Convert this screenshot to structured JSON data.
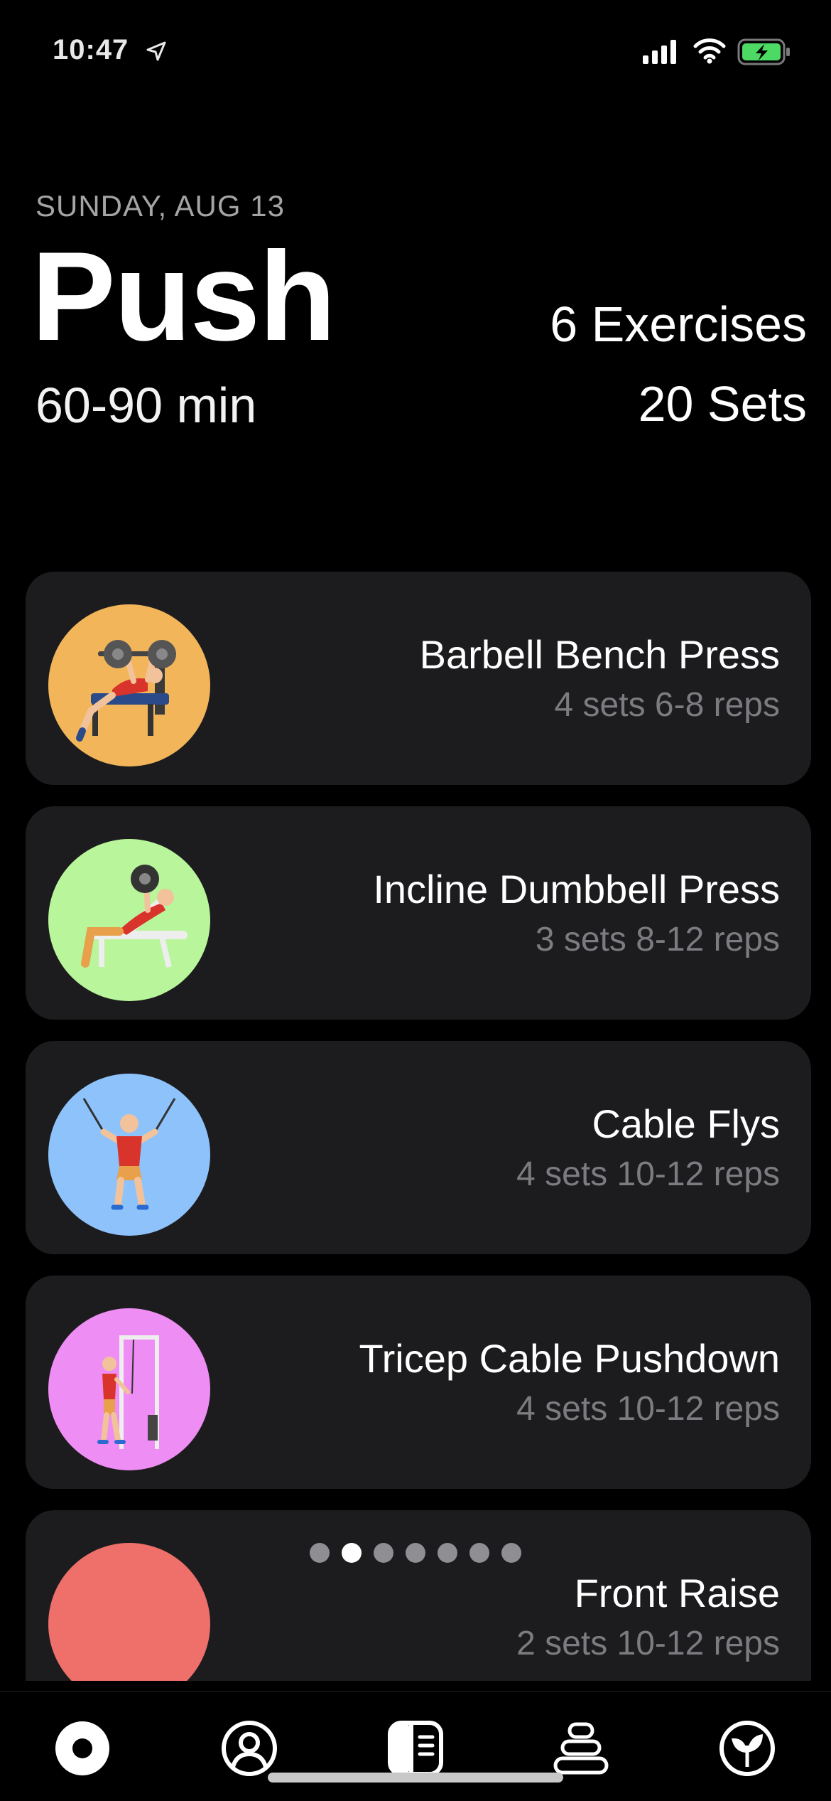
{
  "status_bar": {
    "time": "10:47"
  },
  "header": {
    "date": "SUNDAY, AUG 13",
    "title": "Push",
    "duration": "60-90 min",
    "exercise_count": "6 Exercises",
    "set_count": "20 Sets"
  },
  "exercises": [
    {
      "name": "Barbell Bench Press",
      "meta": "4 sets 6-8 reps",
      "color": "#f2b55a",
      "icon": "bench-press-illustration"
    },
    {
      "name": "Incline Dumbbell Press",
      "meta": "3 sets 8-12 reps",
      "color": "#b9f59a",
      "icon": "incline-press-illustration"
    },
    {
      "name": "Cable Flys",
      "meta": "4 sets 10-12 reps",
      "color": "#8ec2fb",
      "icon": "cable-fly-illustration"
    },
    {
      "name": "Tricep Cable Pushdown",
      "meta": "4 sets 10-12 reps",
      "color": "#ee8df3",
      "icon": "tricep-pushdown-illustration"
    },
    {
      "name": "Front Raise",
      "meta": "2 sets 10-12 reps",
      "color": "#ef6f6a",
      "icon": "front-raise-illustration"
    }
  ],
  "pagination": {
    "total": 7,
    "active_index": 1
  },
  "tab_bar": {
    "tabs": [
      {
        "icon": "record-icon",
        "selected": true
      },
      {
        "icon": "profile-icon",
        "selected": false
      },
      {
        "icon": "journal-icon",
        "selected": false
      },
      {
        "icon": "stack-icon",
        "selected": false
      },
      {
        "icon": "leaf-icon",
        "selected": false
      }
    ]
  }
}
